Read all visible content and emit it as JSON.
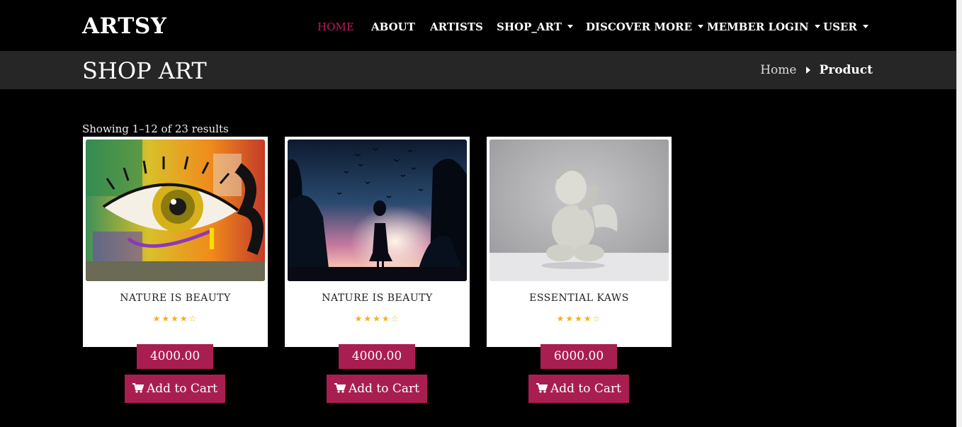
{
  "brand": "ARTSY",
  "nav": {
    "home": "HOME",
    "about": "ABOUT",
    "artists": "ARTISTS",
    "shop_art": "SHOP_ART",
    "discover_more": "DISCOVER MORE",
    "member_login": "MEMBER LOGIN",
    "user": "USER"
  },
  "page_title": "SHOP ART",
  "breadcrumb": {
    "home": "Home",
    "current": "Product"
  },
  "results_text": "Showing 1–12 of 23 results",
  "products": [
    {
      "name": "NATURE IS BEAUTY",
      "stars": "★★★★☆",
      "rating": 4,
      "price": "4000.00",
      "cart_label": "Add to Cart",
      "image": "colorful eye street mural"
    },
    {
      "name": "NATURE IS BEAUTY",
      "stars": "★★★★☆",
      "rating": 4,
      "price": "4000.00",
      "cart_label": "Add to Cart",
      "image": "silhouette of girl at sunset with birds"
    },
    {
      "name": "ESSENTIAL KAWS",
      "stars": "★★★★☆",
      "rating": 4,
      "price": "6000.00",
      "cart_label": "Add to Cart",
      "image": "white cherub figurine"
    }
  ],
  "colors": {
    "accent": "#a91e50",
    "active_nav": "#c2185b",
    "star": "#f2b01e",
    "title_bar": "#262626"
  }
}
